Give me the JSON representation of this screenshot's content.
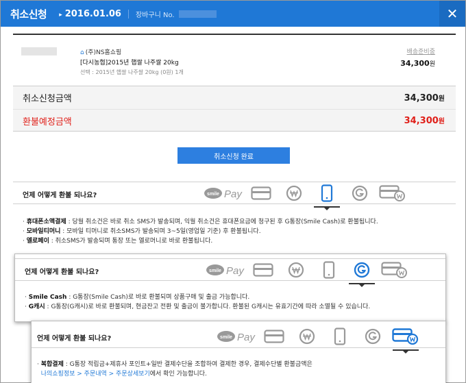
{
  "header": {
    "title": "취소신청",
    "date": "2016.01.06",
    "cart_label": "장바구니 No."
  },
  "product": {
    "shop": "(주)NS홈쇼핑",
    "name": "[다시농협]2015년 햅쌀 나주쌀 20kg",
    "option": "선택 : 2015년 햅쌀 나주쌀 20kg (0원) 1개",
    "status": "배송준비중",
    "price": "34,300",
    "price_unit": "원"
  },
  "summary": {
    "cancel_label": "취소신청금액",
    "cancel_amount": "34,300",
    "refund_label": "환불예정금액",
    "refund_amount": "34,300",
    "unit": "원"
  },
  "complete_button": "취소신청 완료",
  "question": "언제 어떻게 환불 되나요?",
  "icons": {
    "smile_label": "smile",
    "pay_label": "Pay"
  },
  "panel1": {
    "lines": [
      {
        "term": "휴대폰소액결제",
        "text": " : 당월 취소건은 바로 취소 SMS가 발송되며, 익월 취소건은 휴대폰요금에 청구된 후 G통장(Smile Cash)로 환불됩니다."
      },
      {
        "term": "모바일티머니",
        "text": " : 모바일 티머니로 취소SMS가 발송되며 3~5일(영업일 기준) 후 환불됩니다."
      },
      {
        "term": "엘로페이",
        "text": " : 취소SMS가 발송되며 통장 또는 엘로머니로 바로 환불됩니다."
      }
    ]
  },
  "panel2": {
    "lines": [
      {
        "term": "Smile Cash",
        "text": " : G통장(Smile Cash)로 바로 환불되며 상품구매 및 출금 가능합니다."
      },
      {
        "term": "G캐시",
        "text": " : G통장(G캐시)로 바로 환불되며, 현금잔고 전환 및 출금이 불가합니다. 환불된 G캐시는 유효기간에 따라 소멸될 수 있습니다."
      }
    ]
  },
  "panel3": {
    "term": "복합결제",
    "text": " : G통장 적립금+제휴사 포인트+일반 결제수단을 조합하여 결제한 경우, 결제수단별 환불금액은",
    "link": "나의쇼핑정보 > 주문내역 > 주문상세보기",
    "text2": "에서 확인 가능합니다."
  },
  "colors": {
    "header_bg": "#1f78d6",
    "refund_red": "#e0201a",
    "button_blue": "#2d7fe0",
    "active_icon": "#1f78d6"
  }
}
